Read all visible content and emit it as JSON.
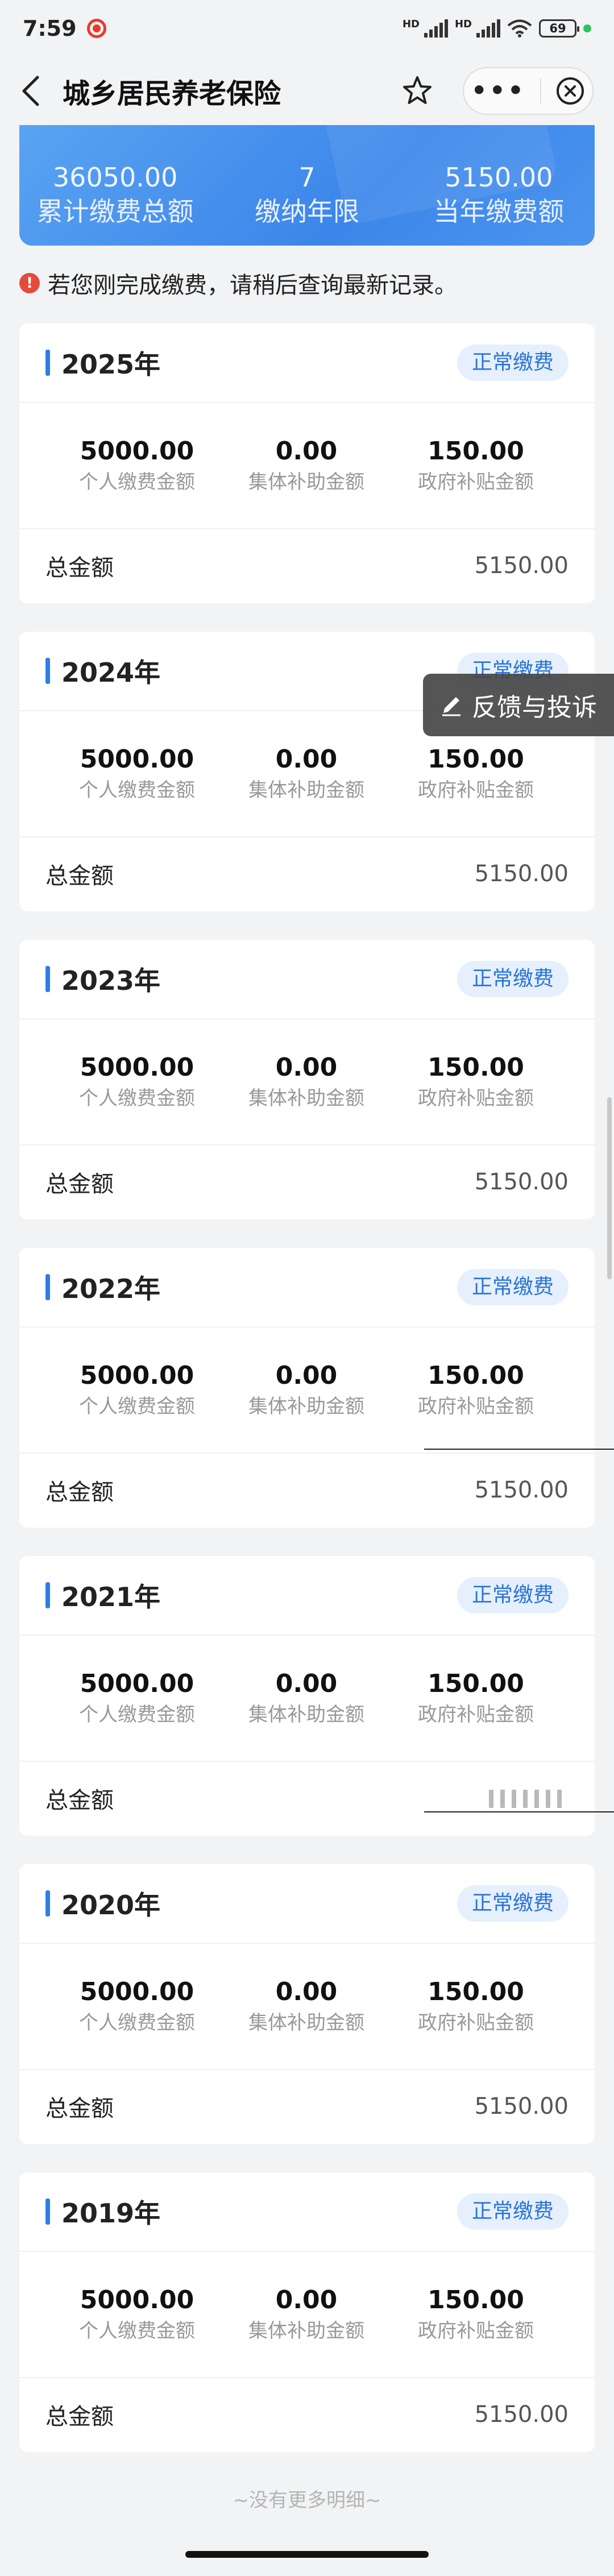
{
  "status_bar": {
    "time": "7:59",
    "battery": "69"
  },
  "nav": {
    "title": "城乡居民养老保险"
  },
  "summary": [
    {
      "value": "36050.00",
      "label": "累计缴费总额"
    },
    {
      "value": "7",
      "label": "缴纳年限"
    },
    {
      "value": "5150.00",
      "label": "当年缴费额"
    }
  ],
  "notice": "若您刚完成缴费，请稍后查询最新记录。",
  "labels": {
    "personal": "个人缴费金额",
    "collective": "集体补助金额",
    "government": "政府补贴金额",
    "total": "总金额"
  },
  "records": [
    {
      "year": "2025年",
      "status": "正常缴费",
      "personal": "5000.00",
      "collective": "0.00",
      "government": "150.00",
      "total": "5150.00"
    },
    {
      "year": "2024年",
      "status": "正常缴费",
      "personal": "5000.00",
      "collective": "0.00",
      "government": "150.00",
      "total": "5150.00"
    },
    {
      "year": "2023年",
      "status": "正常缴费",
      "personal": "5000.00",
      "collective": "0.00",
      "government": "150.00",
      "total": "5150.00"
    },
    {
      "year": "2022年",
      "status": "正常缴费",
      "personal": "5000.00",
      "collective": "0.00",
      "government": "150.00",
      "total": "5150.00"
    },
    {
      "year": "2021年",
      "status": "正常缴费",
      "personal": "5000.00",
      "collective": "0.00",
      "government": "150.00",
      "total": ""
    },
    {
      "year": "2020年",
      "status": "正常缴费",
      "personal": "5000.00",
      "collective": "0.00",
      "government": "150.00",
      "total": "5150.00"
    },
    {
      "year": "2019年",
      "status": "正常缴费",
      "personal": "5000.00",
      "collective": "0.00",
      "government": "150.00",
      "total": "5150.00"
    }
  ],
  "feedback_button": "反馈与投诉",
  "end_text": "~没有更多明细~"
}
